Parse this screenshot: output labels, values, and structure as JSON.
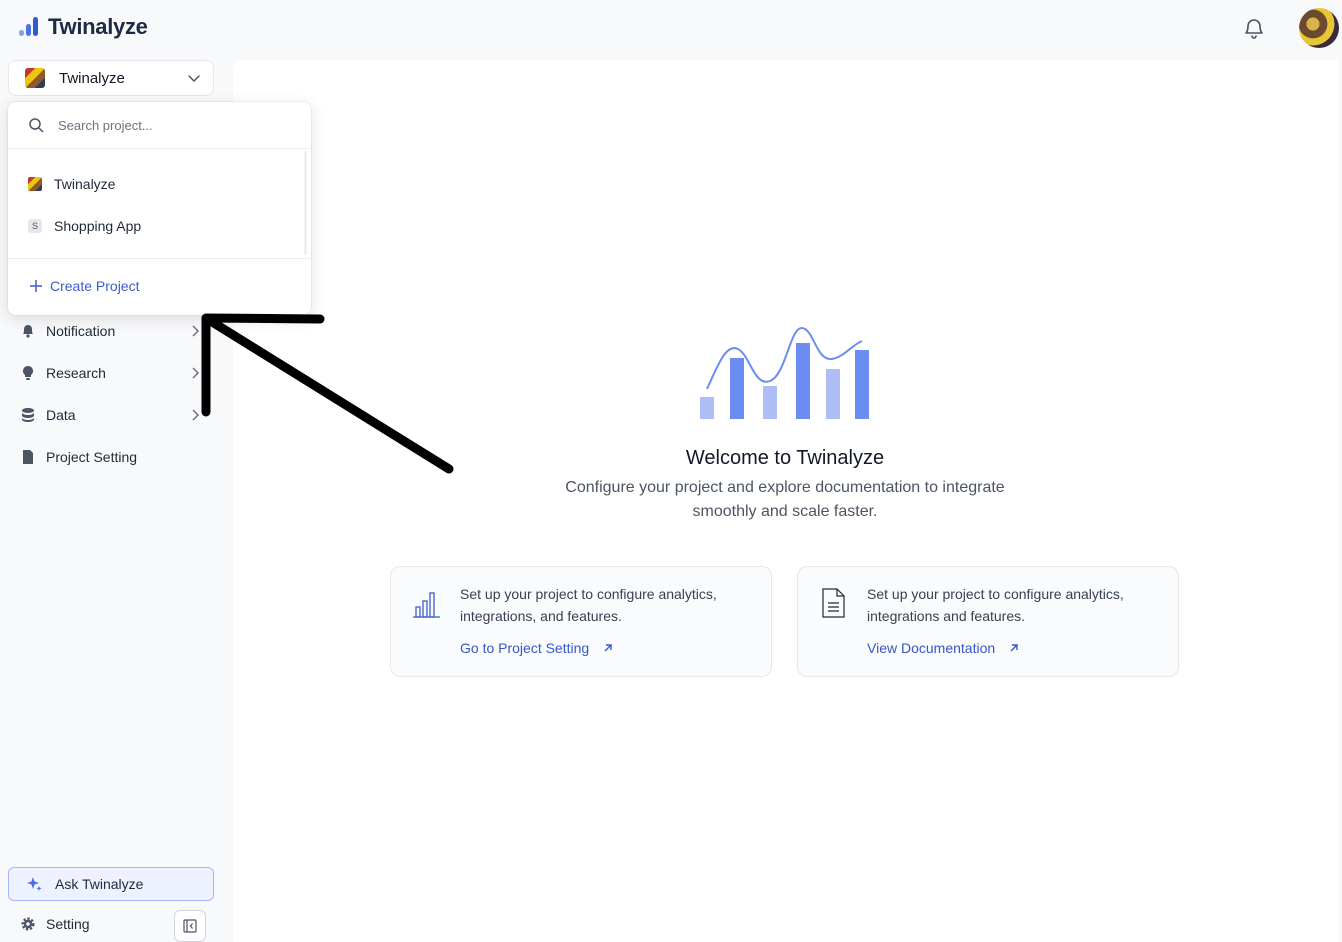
{
  "app": {
    "name": "Twinalyze"
  },
  "project_selector": {
    "current": "Twinalyze"
  },
  "dropdown": {
    "search_placeholder": "Search project...",
    "projects": [
      {
        "label": "Twinalyze",
        "badge": ""
      },
      {
        "label": "Shopping App",
        "badge": "S"
      }
    ],
    "create_label": "Create Project"
  },
  "sidebar": {
    "items": [
      {
        "label": "Notification"
      },
      {
        "label": "Research"
      },
      {
        "label": "Data"
      },
      {
        "label": "Project Setting"
      }
    ],
    "ask_label": "Ask Twinalyze",
    "setting_label": "Setting"
  },
  "welcome": {
    "title": "Welcome to Twinalyze",
    "subtitle": "Configure your project and explore documentation to integrate smoothly and scale faster."
  },
  "cards": [
    {
      "text": "Set up your project to configure analytics, integrations, and features.",
      "link": "Go to Project Setting",
      "icon": "bar-chart-icon"
    },
    {
      "text": "Set up your project to configure analytics, integrations and features.",
      "link": "View Documentation",
      "icon": "document-icon"
    }
  ],
  "colors": {
    "accent": "#3d5ccc",
    "bar_dark": "#6b8cf0",
    "bar_light": "#aebdf5"
  }
}
